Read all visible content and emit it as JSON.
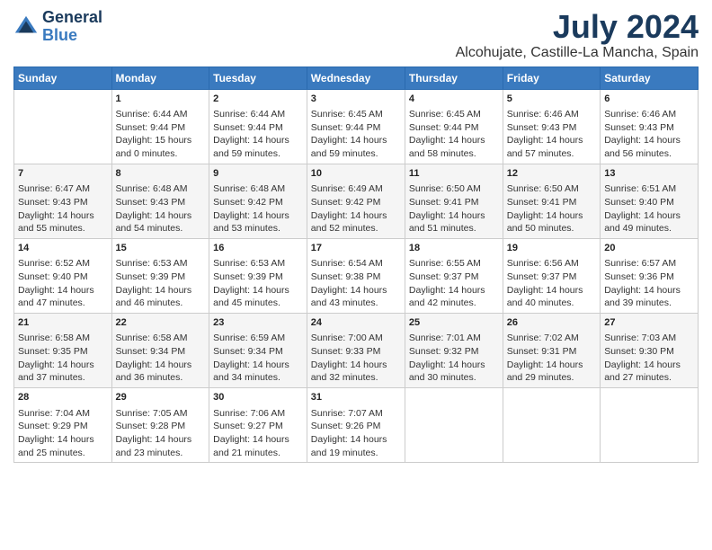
{
  "header": {
    "logo_line1": "General",
    "logo_line2": "Blue",
    "month": "July 2024",
    "location": "Alcohujate, Castille-La Mancha, Spain"
  },
  "days_of_week": [
    "Sunday",
    "Monday",
    "Tuesday",
    "Wednesday",
    "Thursday",
    "Friday",
    "Saturday"
  ],
  "weeks": [
    [
      {
        "day": "",
        "sunrise": "",
        "sunset": "",
        "daylight": ""
      },
      {
        "day": "1",
        "sunrise": "Sunrise: 6:44 AM",
        "sunset": "Sunset: 9:44 PM",
        "daylight": "Daylight: 15 hours and 0 minutes."
      },
      {
        "day": "2",
        "sunrise": "Sunrise: 6:44 AM",
        "sunset": "Sunset: 9:44 PM",
        "daylight": "Daylight: 14 hours and 59 minutes."
      },
      {
        "day": "3",
        "sunrise": "Sunrise: 6:45 AM",
        "sunset": "Sunset: 9:44 PM",
        "daylight": "Daylight: 14 hours and 59 minutes."
      },
      {
        "day": "4",
        "sunrise": "Sunrise: 6:45 AM",
        "sunset": "Sunset: 9:44 PM",
        "daylight": "Daylight: 14 hours and 58 minutes."
      },
      {
        "day": "5",
        "sunrise": "Sunrise: 6:46 AM",
        "sunset": "Sunset: 9:43 PM",
        "daylight": "Daylight: 14 hours and 57 minutes."
      },
      {
        "day": "6",
        "sunrise": "Sunrise: 6:46 AM",
        "sunset": "Sunset: 9:43 PM",
        "daylight": "Daylight: 14 hours and 56 minutes."
      }
    ],
    [
      {
        "day": "7",
        "sunrise": "Sunrise: 6:47 AM",
        "sunset": "Sunset: 9:43 PM",
        "daylight": "Daylight: 14 hours and 55 minutes."
      },
      {
        "day": "8",
        "sunrise": "Sunrise: 6:48 AM",
        "sunset": "Sunset: 9:43 PM",
        "daylight": "Daylight: 14 hours and 54 minutes."
      },
      {
        "day": "9",
        "sunrise": "Sunrise: 6:48 AM",
        "sunset": "Sunset: 9:42 PM",
        "daylight": "Daylight: 14 hours and 53 minutes."
      },
      {
        "day": "10",
        "sunrise": "Sunrise: 6:49 AM",
        "sunset": "Sunset: 9:42 PM",
        "daylight": "Daylight: 14 hours and 52 minutes."
      },
      {
        "day": "11",
        "sunrise": "Sunrise: 6:50 AM",
        "sunset": "Sunset: 9:41 PM",
        "daylight": "Daylight: 14 hours and 51 minutes."
      },
      {
        "day": "12",
        "sunrise": "Sunrise: 6:50 AM",
        "sunset": "Sunset: 9:41 PM",
        "daylight": "Daylight: 14 hours and 50 minutes."
      },
      {
        "day": "13",
        "sunrise": "Sunrise: 6:51 AM",
        "sunset": "Sunset: 9:40 PM",
        "daylight": "Daylight: 14 hours and 49 minutes."
      }
    ],
    [
      {
        "day": "14",
        "sunrise": "Sunrise: 6:52 AM",
        "sunset": "Sunset: 9:40 PM",
        "daylight": "Daylight: 14 hours and 47 minutes."
      },
      {
        "day": "15",
        "sunrise": "Sunrise: 6:53 AM",
        "sunset": "Sunset: 9:39 PM",
        "daylight": "Daylight: 14 hours and 46 minutes."
      },
      {
        "day": "16",
        "sunrise": "Sunrise: 6:53 AM",
        "sunset": "Sunset: 9:39 PM",
        "daylight": "Daylight: 14 hours and 45 minutes."
      },
      {
        "day": "17",
        "sunrise": "Sunrise: 6:54 AM",
        "sunset": "Sunset: 9:38 PM",
        "daylight": "Daylight: 14 hours and 43 minutes."
      },
      {
        "day": "18",
        "sunrise": "Sunrise: 6:55 AM",
        "sunset": "Sunset: 9:37 PM",
        "daylight": "Daylight: 14 hours and 42 minutes."
      },
      {
        "day": "19",
        "sunrise": "Sunrise: 6:56 AM",
        "sunset": "Sunset: 9:37 PM",
        "daylight": "Daylight: 14 hours and 40 minutes."
      },
      {
        "day": "20",
        "sunrise": "Sunrise: 6:57 AM",
        "sunset": "Sunset: 9:36 PM",
        "daylight": "Daylight: 14 hours and 39 minutes."
      }
    ],
    [
      {
        "day": "21",
        "sunrise": "Sunrise: 6:58 AM",
        "sunset": "Sunset: 9:35 PM",
        "daylight": "Daylight: 14 hours and 37 minutes."
      },
      {
        "day": "22",
        "sunrise": "Sunrise: 6:58 AM",
        "sunset": "Sunset: 9:34 PM",
        "daylight": "Daylight: 14 hours and 36 minutes."
      },
      {
        "day": "23",
        "sunrise": "Sunrise: 6:59 AM",
        "sunset": "Sunset: 9:34 PM",
        "daylight": "Daylight: 14 hours and 34 minutes."
      },
      {
        "day": "24",
        "sunrise": "Sunrise: 7:00 AM",
        "sunset": "Sunset: 9:33 PM",
        "daylight": "Daylight: 14 hours and 32 minutes."
      },
      {
        "day": "25",
        "sunrise": "Sunrise: 7:01 AM",
        "sunset": "Sunset: 9:32 PM",
        "daylight": "Daylight: 14 hours and 30 minutes."
      },
      {
        "day": "26",
        "sunrise": "Sunrise: 7:02 AM",
        "sunset": "Sunset: 9:31 PM",
        "daylight": "Daylight: 14 hours and 29 minutes."
      },
      {
        "day": "27",
        "sunrise": "Sunrise: 7:03 AM",
        "sunset": "Sunset: 9:30 PM",
        "daylight": "Daylight: 14 hours and 27 minutes."
      }
    ],
    [
      {
        "day": "28",
        "sunrise": "Sunrise: 7:04 AM",
        "sunset": "Sunset: 9:29 PM",
        "daylight": "Daylight: 14 hours and 25 minutes."
      },
      {
        "day": "29",
        "sunrise": "Sunrise: 7:05 AM",
        "sunset": "Sunset: 9:28 PM",
        "daylight": "Daylight: 14 hours and 23 minutes."
      },
      {
        "day": "30",
        "sunrise": "Sunrise: 7:06 AM",
        "sunset": "Sunset: 9:27 PM",
        "daylight": "Daylight: 14 hours and 21 minutes."
      },
      {
        "day": "31",
        "sunrise": "Sunrise: 7:07 AM",
        "sunset": "Sunset: 9:26 PM",
        "daylight": "Daylight: 14 hours and 19 minutes."
      },
      {
        "day": "",
        "sunrise": "",
        "sunset": "",
        "daylight": ""
      },
      {
        "day": "",
        "sunrise": "",
        "sunset": "",
        "daylight": ""
      },
      {
        "day": "",
        "sunrise": "",
        "sunset": "",
        "daylight": ""
      }
    ]
  ]
}
